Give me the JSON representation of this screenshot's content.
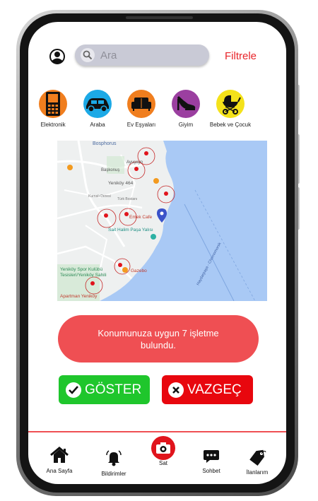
{
  "search": {
    "placeholder": "Ara"
  },
  "header": {
    "filter_label": "Filtrele"
  },
  "categories": [
    {
      "label": "Elektronik",
      "icon": "phone-icon",
      "color": "#f07e1e"
    },
    {
      "label": "Araba",
      "icon": "car-icon",
      "color": "#1ca9e6"
    },
    {
      "label": "Ev Eşyaları",
      "icon": "sofa-icon",
      "color": "#f07e1e"
    },
    {
      "label": "Giyim",
      "icon": "high-heel-icon",
      "color": "#9b3fa0"
    },
    {
      "label": "Bebek ve Çocuk",
      "icon": "stroller-icon",
      "color": "#f4e21a"
    }
  ],
  "map": {
    "labels": [
      "Bosphorus",
      "Ayuşeyo",
      "Başkonuş",
      "Yeniköy 464",
      "Türk Bostanı",
      "Kurnalı Deresi",
      "Emek Cafe",
      "Sait Halim Paşa Yalısı",
      "Yeniköy Spor Kulübü",
      "Tesisleri/Yeniköy Sahili",
      "Gazebo",
      "Apartman Yeniköy",
      "Haydarpaşa - Chornomorsk"
    ]
  },
  "banner": {
    "text": "Konumunuza uygun 7 işletme bulundu."
  },
  "actions": {
    "show_label": "GÖSTER",
    "cancel_label": "VAZGEÇ"
  },
  "bottom_nav": [
    {
      "label": "Ana Sayfa",
      "icon": "home-icon"
    },
    {
      "label": "Bildirimler",
      "icon": "bell-icon"
    },
    {
      "label": "Sat",
      "icon": "camera-icon"
    },
    {
      "label": "Sohbet",
      "icon": "chat-icon"
    },
    {
      "label": "İlanlarım",
      "icon": "tag-icon"
    }
  ],
  "colors": {
    "accent": "#ef4f53",
    "filter": "#e8242a",
    "show": "#1fc62c",
    "cancel": "#e8070e"
  }
}
